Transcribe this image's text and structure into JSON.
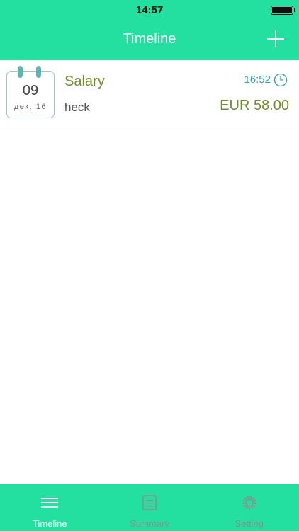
{
  "status": {
    "time": "14:57"
  },
  "nav": {
    "title": "Timeline",
    "add_icon": "plus-icon"
  },
  "entries": [
    {
      "day": "09",
      "month_year": "дек. 16",
      "title": "Salary",
      "note": "heck",
      "time": "16:52",
      "amount": "EUR 58.00"
    }
  ],
  "tabs": [
    {
      "label": "Timeline",
      "icon": "menu-lines-icon",
      "active": true
    },
    {
      "label": "Summary",
      "icon": "document-icon",
      "active": false
    },
    {
      "label": "Setting",
      "icon": "gear-icon",
      "active": false
    }
  ],
  "colors": {
    "accent": "#23e0a0",
    "income_text": "#6f8f2a",
    "time_text": "#2aa6a0"
  }
}
